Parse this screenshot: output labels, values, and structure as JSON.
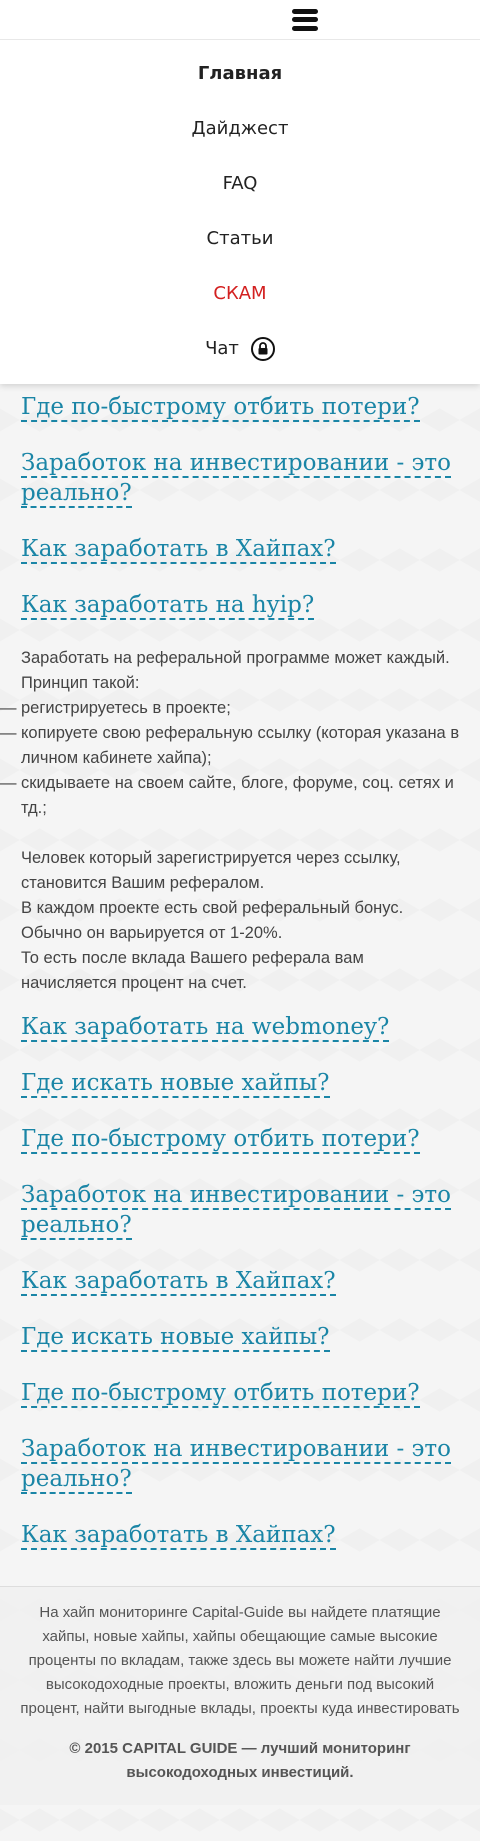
{
  "menu": {
    "items": [
      {
        "label": "Главная"
      },
      {
        "label": "Дайджест"
      },
      {
        "label": "FAQ"
      },
      {
        "label": "Статьи"
      },
      {
        "label": "СКАМ"
      },
      {
        "label": "Чат"
      }
    ],
    "icons": {
      "burger": "hamburger-menu-icon",
      "lock": "lock-icon"
    },
    "scam_color": "#d32020"
  },
  "content": {
    "links_top": [
      "Где по-быстрому отбить потери?",
      "Заработок на инвестировании - это реально?",
      "Как заработать в Хайпах?",
      "Как заработать на hyip?"
    ],
    "article": {
      "intro": [
        "Заработать на реферальной программе может каждый.",
        "Принцип такой:"
      ],
      "steps": [
        "регистрируетесь в проекте;",
        "копируете свою реферальную ссылку (которая указана в личном кабинете хайпа);",
        "скидываете на своем сайте, блоге, форуме, соц. сетях и тд.;"
      ],
      "body": [
        "Человек который зарегистрируется через ссылку, становится Вашим рефералом.",
        "В каждом проекте есть свой реферальный бонус. Обычно он варьируется от 1-20%.",
        "То есть после вклада Вашего реферала вам начисляется процент на счет."
      ]
    },
    "links_bottom": [
      "Как заработать на webmoney?",
      "Где искать новые хайпы?",
      "Где по-быстрому отбить потери?",
      "Заработок на инвестировании - это реально?",
      "Как заработать в Хайпах?",
      "Где искать новые хайпы?",
      "Где по-быстрому отбить потери?",
      "Заработок на инвестировании - это реально?",
      "Как заработать в Хайпах?"
    ],
    "link_color": "#1a85a6"
  },
  "footer": {
    "text": "На хайп мониторинге Capital-Guide вы найдете платящие хайпы, новые хайпы, хайпы обещающие самые высокие проценты по вкладам, также здесь вы можете найти лучшие высокодоходные проекты, вложить деньги под  высокий процент, найти выгодные вклады, проекты куда инвестировать деньги, статьи о заработке в интернете и о том куда инвестировать деньги, реально ли заработать в интернете и",
    "copyright": "© 2015 CAPITAL GUIDE — лучший мониторинг высокодоходных инвестиций."
  }
}
